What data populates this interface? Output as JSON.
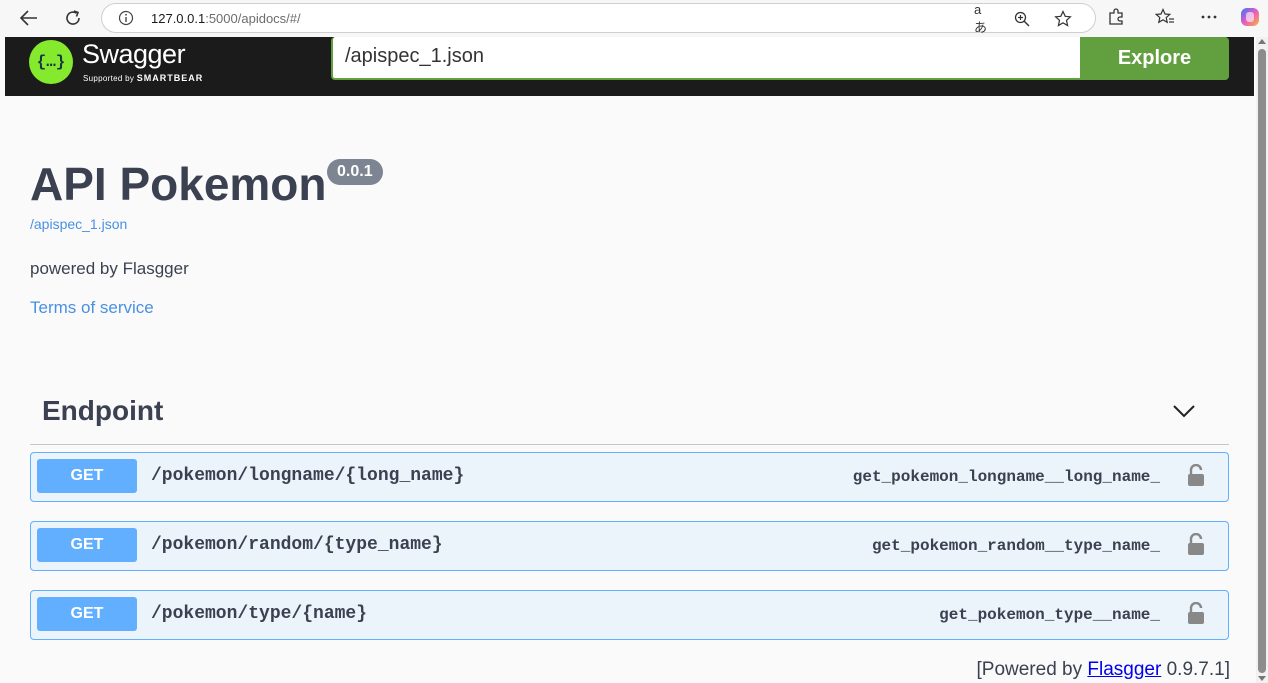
{
  "browser": {
    "url_host": "127.0.0.1",
    "url_rest": ":5000/apidocs/#/"
  },
  "swagger": {
    "logo_text": "Swagger",
    "logo_supported": "Supported by",
    "logo_brand": "SMARTBEAR",
    "spec_url": "/apispec_1.json",
    "explore_label": "Explore"
  },
  "info": {
    "title": "API Pokemon",
    "version": "0.0.1",
    "spec_link": "/apispec_1.json",
    "description": "powered by Flasgger",
    "terms": "Terms of service"
  },
  "tag": {
    "name": "Endpoint"
  },
  "operations": [
    {
      "method": "GET",
      "path": "/pokemon/longname/{long_name}",
      "operation_id": "get_pokemon_longname__long_name_"
    },
    {
      "method": "GET",
      "path": "/pokemon/random/{type_name}",
      "operation_id": "get_pokemon_random__type_name_"
    },
    {
      "method": "GET",
      "path": "/pokemon/type/{name}",
      "operation_id": "get_pokemon_type__name_"
    }
  ],
  "footer": {
    "prefix": "[Powered by ",
    "link": "Flasgger",
    "suffix": " 0.9.7.1]"
  }
}
